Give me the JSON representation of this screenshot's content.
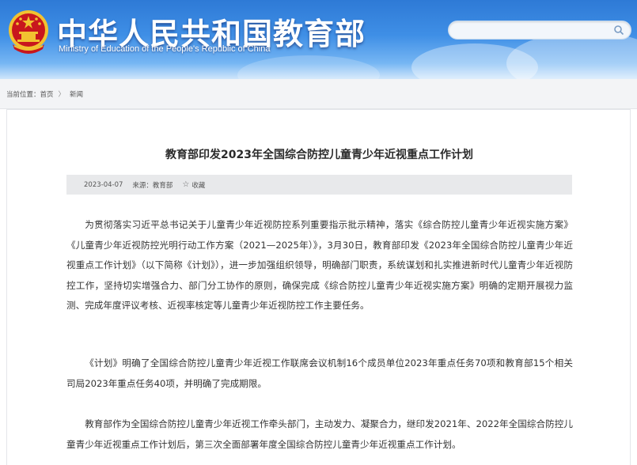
{
  "header": {
    "title_cn": "中华人民共和国教育部",
    "title_en": "Ministry of Education of the People's Republic of China",
    "search_placeholder": "",
    "colors": {
      "sky_top": "#2e7ad6",
      "sky_bottom": "#cfe6fb",
      "emblem_red": "#c8161d",
      "emblem_gold": "#f2c230"
    }
  },
  "breadcrumb": {
    "prefix": "当前位置：",
    "items": [
      "首页",
      "新闻"
    ],
    "separator": "〉"
  },
  "article": {
    "title": "教育部印发2023年全国综合防控儿童青少年近视重点工作计划",
    "date": "2023-04-07",
    "source": "来源：教育部",
    "favorite_label": "收藏",
    "paragraphs": [
      "为贯彻落实习近平总书记关于儿童青少年近视防控系列重要指示批示精神，落实《综合防控儿童青少年近视实施方案》《儿童青少年近视防控光明行动工作方案（2021—2025年）》，3月30日，教育部印发《2023年全国综合防控儿童青少年近视重点工作计划》（以下简称《计划》），进一步加强组织领导，明确部门职责，系统谋划和扎实推进新时代儿童青少年近视防控工作，坚持切实增强合力、部门分工协作的原则，确保完成《综合防控儿童青少年近视实施方案》明确的定期开展视力监测、完成年度评议考核、近视率核定等儿童青少年近视防控工作主要任务。",
      "《计划》明确了全国综合防控儿童青少年近视工作联席会议机制16个成员单位2023年重点任务70项和教育部15个相关司局2023年重点任务40项，并明确了完成期限。",
      "教育部作为全国综合防控儿童青少年近视工作牵头部门，主动发力、凝聚合力，继印发2021年、2022年全国综合防控儿童青少年近视重点工作计划后，第三次全面部署年度全国综合防控儿童青少年近视重点工作计划。"
    ]
  }
}
